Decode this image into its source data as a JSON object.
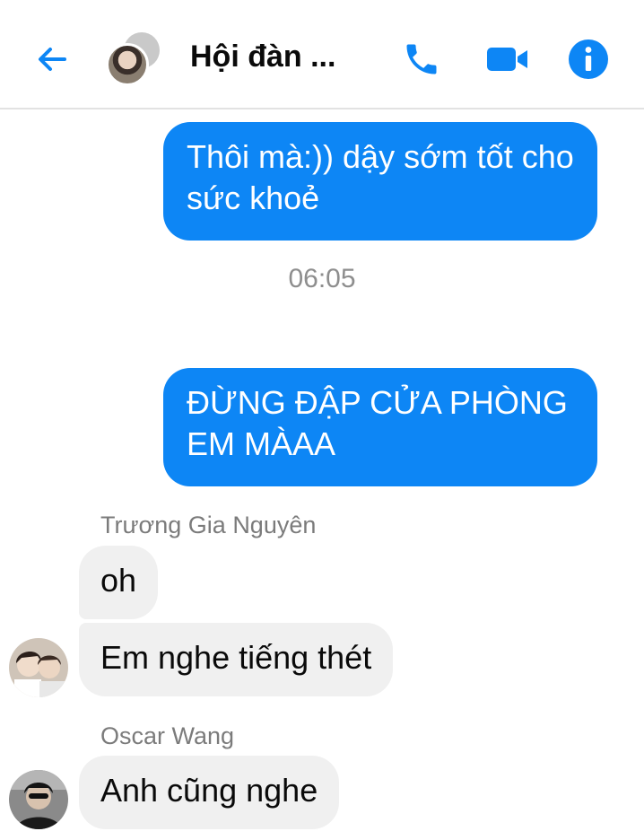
{
  "header": {
    "title": "Hội đàn ...",
    "back_icon": "back-arrow-icon",
    "call_icon": "phone-icon",
    "video_icon": "video-camera-icon",
    "info_icon": "info-icon",
    "accent_color": "#0d86f5"
  },
  "messages": {
    "outgoing_1": "Thôi mà:)) dậy sớm tốt cho sức khoẻ",
    "timestamp": "06:05",
    "outgoing_2": "ĐỪNG ĐẬP CỬA PHÒNG EM MÀAA",
    "sender_1": "Trương Gia Nguyên",
    "incoming_1": "oh",
    "incoming_2": "Em nghe tiếng thét",
    "sender_2": "Oscar Wang",
    "incoming_3": "Anh cũng nghe"
  }
}
